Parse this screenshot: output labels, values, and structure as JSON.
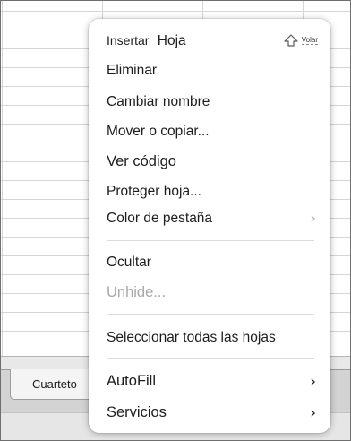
{
  "menu": {
    "insert": "Insertar",
    "insert_suffix": "Hoja",
    "fly_label": "Volar",
    "delete": "Eliminar",
    "rename": "Cambiar nombre",
    "move_copy": "Mover o copiar...",
    "view_code": "Ver código",
    "protect": "Proteger hoja...",
    "tab_color": "Color de pestaña",
    "hide": "Ocultar",
    "unhide": "Unhide...",
    "select_all": "Seleccionar todas las hojas",
    "autofill": "AutoFill",
    "services": "Servicios"
  },
  "sheet_tabs": {
    "active": "Cuarteto"
  },
  "icons": {
    "submenu": "chevron-right-icon",
    "fly": "arrow-up-outline-icon"
  }
}
